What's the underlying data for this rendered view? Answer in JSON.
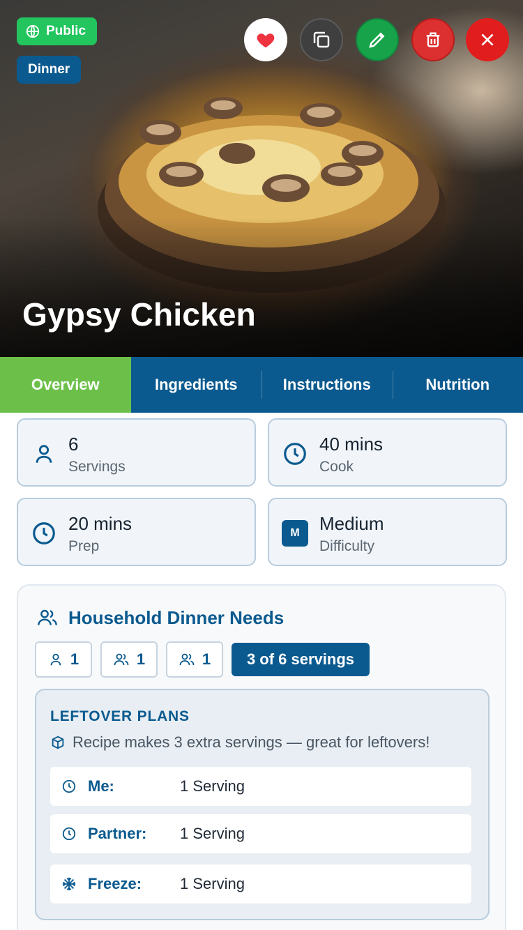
{
  "hero": {
    "title": "Gypsy Chicken",
    "badges": {
      "visibility": "Public",
      "category": "Dinner"
    },
    "actions": [
      "favorite-heart-icon",
      "copy-icon",
      "edit-pencil-icon",
      "trash-icon",
      "close-icon"
    ]
  },
  "tabs": [
    {
      "label": "Overview",
      "active": true
    },
    {
      "label": "Ingredients",
      "active": false
    },
    {
      "label": "Instructions",
      "active": false
    },
    {
      "label": "Nutrition",
      "active": false
    }
  ],
  "stats": {
    "servings": {
      "value": "6",
      "label": "Servings"
    },
    "cook": {
      "value": "40 mins",
      "label": "Cook"
    },
    "prep": {
      "value": "20 mins",
      "label": "Prep"
    },
    "difficulty": {
      "value": "Medium",
      "label": "Difficulty",
      "badge": "M"
    }
  },
  "household": {
    "title": "Household Dinner Needs",
    "chips": [
      {
        "count": "1",
        "icon": "single-person-icon"
      },
      {
        "count": "1",
        "icon": "two-people-icon"
      },
      {
        "count": "1",
        "icon": "two-people-icon"
      }
    ],
    "servings_summary": "3 of 6 servings",
    "leftovers": {
      "title": "LEFTOVER PLANS",
      "note": "Recipe makes 3 extra servings — great for leftovers!",
      "rows": [
        {
          "who": "Me:",
          "amount": "1 Serving",
          "icon": "clock-icon"
        },
        {
          "who": "Partner:",
          "amount": "1 Serving",
          "icon": "clock-icon"
        },
        {
          "who": "Freeze:",
          "amount": "1 Serving",
          "icon": "snowflake-icon"
        }
      ]
    }
  },
  "colors": {
    "primary": "#0b5a8f",
    "accent_green": "#6cc04a",
    "public_green": "#22c55e",
    "danger": "#dc2f2f"
  }
}
